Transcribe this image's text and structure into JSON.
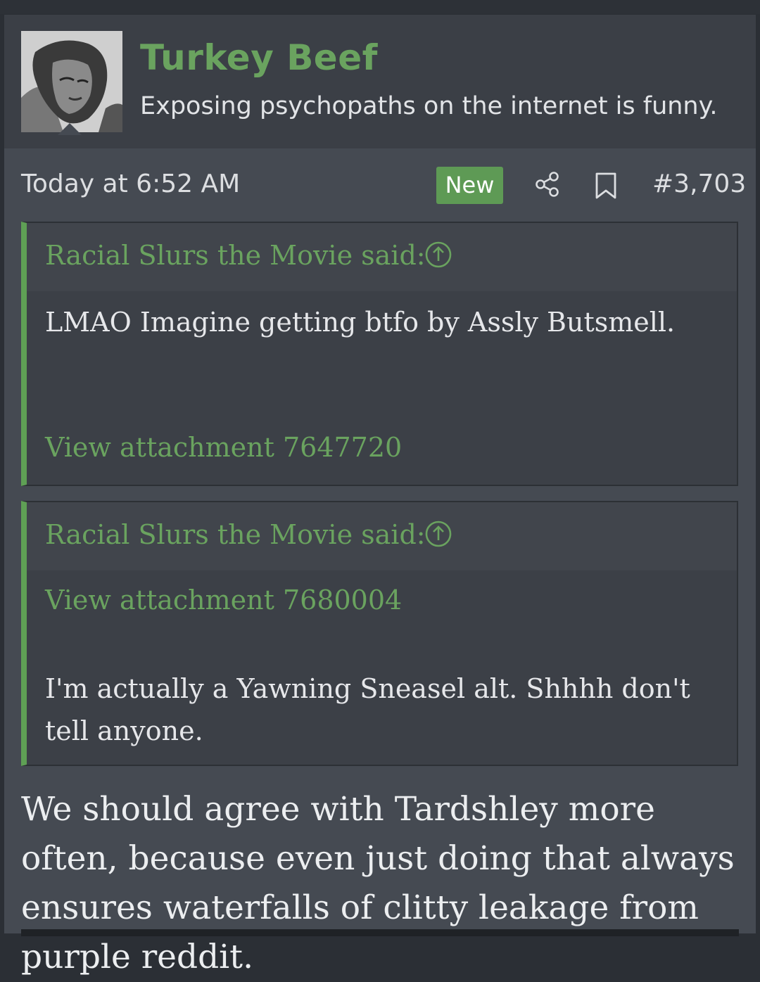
{
  "user": {
    "name": "Turkey Beef",
    "title": "Exposing psychopaths on the internet is funny."
  },
  "meta": {
    "date": "Today at 6:52 AM",
    "badge": "New",
    "post_number": "#3,703"
  },
  "quotes": [
    {
      "author": "Racial Slurs the Movie said:",
      "text": "LMAO Imagine getting btfo by Assly Butsmell.",
      "attachment": "View attachment 7647720"
    },
    {
      "author": "Racial Slurs the Movie said:",
      "attachment": "View attachment 7680004",
      "text": "I'm actually a Yawning Sneasel alt. Shhhh don't tell anyone."
    }
  ],
  "body": "We should agree with Tardshley more often, because even just doing that always ensures waterfalls of clitty leakage from purple reddit."
}
